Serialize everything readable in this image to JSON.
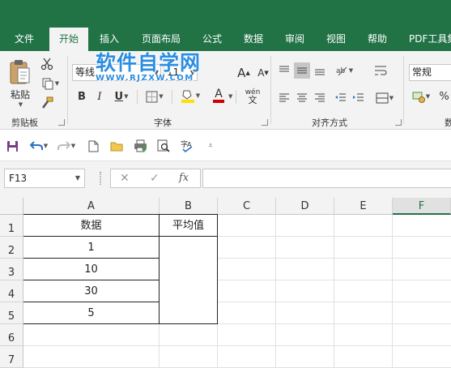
{
  "tabs": [
    "文件",
    "开始",
    "插入",
    "页面布局",
    "公式",
    "数据",
    "审阅",
    "视图",
    "帮助",
    "PDF工具集"
  ],
  "active_tab": "开始",
  "watermark": {
    "title": "软件自学网",
    "url": "WWW.RJZXW.COM"
  },
  "ribbon": {
    "paste_label": "粘贴",
    "clipboard_label": "剪贴板",
    "font_group_label": "字体",
    "font_name": "等线",
    "font_size": "11",
    "bold": "B",
    "italic": "I",
    "underline": "U",
    "grow_font": "A",
    "shrink_font": "A",
    "font_color_letter": "A",
    "phonetic": "wén",
    "alignment_group_label": "对齐方式",
    "number_format": "常规",
    "number_group_partial": "数"
  },
  "formula_bar": {
    "name_box": "F13",
    "cancel": "✕",
    "confirm": "✓",
    "fx": "fx",
    "content": ""
  },
  "columns": [
    "A",
    "B",
    "C",
    "D",
    "E",
    "F"
  ],
  "selected_column": "F",
  "rows": [
    "1",
    "2",
    "3",
    "4",
    "5",
    "6",
    "7"
  ],
  "cells": {
    "A1": "数据",
    "B1": "平均值",
    "A2": "1",
    "A3": "10",
    "A4": "30",
    "A5": "5"
  },
  "colors": {
    "excel_green": "#217346",
    "ribbon_bg": "#f3f3f3",
    "watermark_blue": "#2d8ee0",
    "font_color_red": "#d00000",
    "fill_yellow": "#ffe000"
  }
}
